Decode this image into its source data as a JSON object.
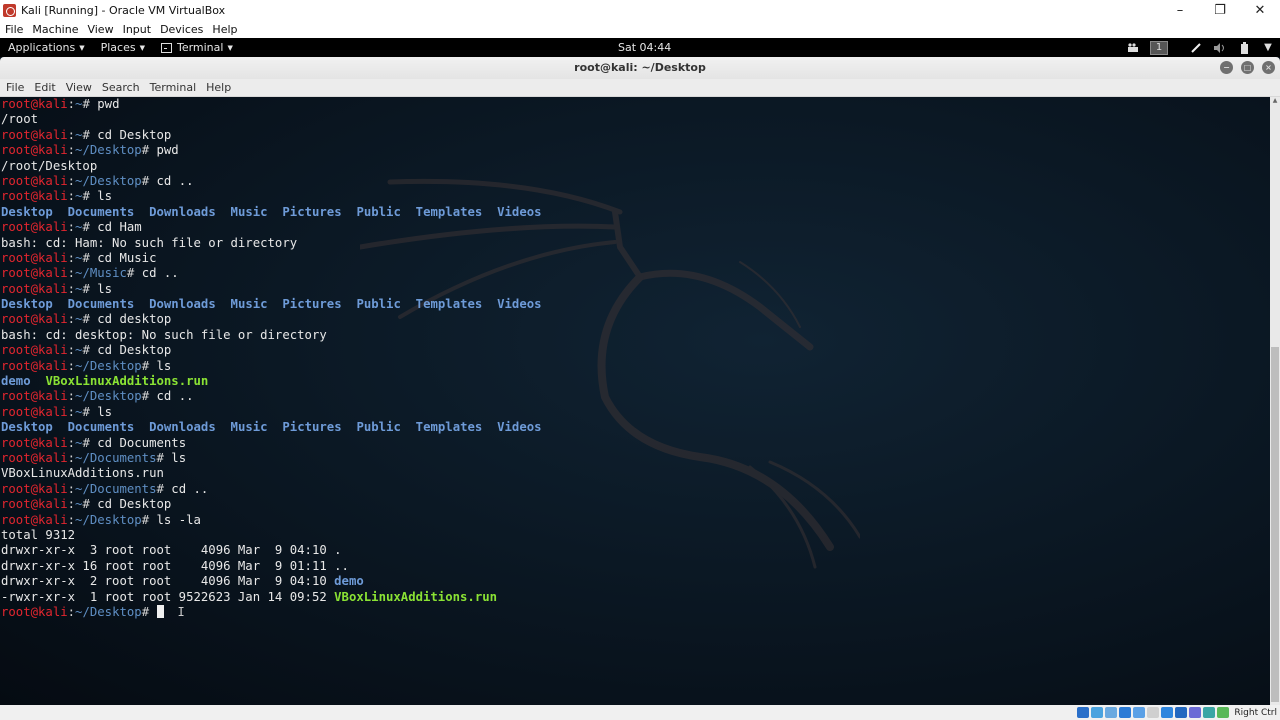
{
  "host": {
    "title": "Kali [Running] - Oracle VM VirtualBox",
    "controls": {
      "minimize": "–",
      "maximize": "❐",
      "close": "✕"
    },
    "menu": [
      "File",
      "Machine",
      "View",
      "Input",
      "Devices",
      "Help"
    ],
    "status": {
      "icons": [
        "hard-disk-icon",
        "optical-drive-icon",
        "audio-icon",
        "network-icon",
        "usb-icon",
        "shared-folder-icon",
        "display-icon",
        "video-capture-icon",
        "virtualbox-icon",
        "mouse-integration-icon",
        "keyboard-icon"
      ],
      "host_key": "Right Ctrl"
    }
  },
  "panel": {
    "applications": "Applications",
    "places": "Places",
    "terminal": "Terminal",
    "clock": "Sat 04:44",
    "workspace": "1",
    "caret": "▼"
  },
  "terminal": {
    "title": "root@kali: ~/Desktop",
    "controls": {
      "minimize": "−",
      "maximize": "□",
      "close": "×"
    },
    "menu": [
      "File",
      "Edit",
      "View",
      "Search",
      "Terminal",
      "Help"
    ],
    "prompt_user": "root@kali",
    "lines": [
      {
        "type": "prompt",
        "path": "~",
        "cmd": "pwd"
      },
      {
        "type": "out",
        "text": "/root"
      },
      {
        "type": "prompt",
        "path": "~",
        "cmd": "cd Desktop"
      },
      {
        "type": "prompt",
        "path": "~/Desktop",
        "cmd": "pwd"
      },
      {
        "type": "out",
        "text": "/root/Desktop"
      },
      {
        "type": "prompt",
        "path": "~/Desktop",
        "cmd": "cd .."
      },
      {
        "type": "prompt",
        "path": "~",
        "cmd": "ls"
      },
      {
        "type": "ls",
        "items": [
          {
            "t": "Desktop",
            "k": "dir"
          },
          {
            "t": "Documents",
            "k": "dir"
          },
          {
            "t": "Downloads",
            "k": "dir"
          },
          {
            "t": "Music",
            "k": "dir"
          },
          {
            "t": "Pictures",
            "k": "dir"
          },
          {
            "t": "Public",
            "k": "dir"
          },
          {
            "t": "Templates",
            "k": "dir"
          },
          {
            "t": "Videos",
            "k": "dir"
          }
        ]
      },
      {
        "type": "prompt",
        "path": "~",
        "cmd": "cd Ham"
      },
      {
        "type": "out",
        "text": "bash: cd: Ham: No such file or directory"
      },
      {
        "type": "prompt",
        "path": "~",
        "cmd": "cd Music"
      },
      {
        "type": "prompt",
        "path": "~/Music",
        "cmd": "cd .."
      },
      {
        "type": "prompt",
        "path": "~",
        "cmd": "ls"
      },
      {
        "type": "ls",
        "items": [
          {
            "t": "Desktop",
            "k": "dir"
          },
          {
            "t": "Documents",
            "k": "dir"
          },
          {
            "t": "Downloads",
            "k": "dir"
          },
          {
            "t": "Music",
            "k": "dir"
          },
          {
            "t": "Pictures",
            "k": "dir"
          },
          {
            "t": "Public",
            "k": "dir"
          },
          {
            "t": "Templates",
            "k": "dir"
          },
          {
            "t": "Videos",
            "k": "dir"
          }
        ]
      },
      {
        "type": "prompt",
        "path": "~",
        "cmd": "cd desktop"
      },
      {
        "type": "out",
        "text": "bash: cd: desktop: No such file or directory"
      },
      {
        "type": "prompt",
        "path": "~",
        "cmd": "cd Desktop"
      },
      {
        "type": "prompt",
        "path": "~/Desktop",
        "cmd": "ls"
      },
      {
        "type": "ls",
        "items": [
          {
            "t": "demo",
            "k": "dir"
          },
          {
            "t": "VBoxLinuxAdditions.run",
            "k": "exe"
          }
        ]
      },
      {
        "type": "prompt",
        "path": "~/Desktop",
        "cmd": "cd .."
      },
      {
        "type": "prompt",
        "path": "~",
        "cmd": "ls"
      },
      {
        "type": "ls",
        "items": [
          {
            "t": "Desktop",
            "k": "dir"
          },
          {
            "t": "Documents",
            "k": "dir"
          },
          {
            "t": "Downloads",
            "k": "dir"
          },
          {
            "t": "Music",
            "k": "dir"
          },
          {
            "t": "Pictures",
            "k": "dir"
          },
          {
            "t": "Public",
            "k": "dir"
          },
          {
            "t": "Templates",
            "k": "dir"
          },
          {
            "t": "Videos",
            "k": "dir"
          }
        ]
      },
      {
        "type": "prompt",
        "path": "~",
        "cmd": "cd Documents"
      },
      {
        "type": "prompt",
        "path": "~/Documents",
        "cmd": "ls"
      },
      {
        "type": "out",
        "text": "VBoxLinuxAdditions.run"
      },
      {
        "type": "prompt",
        "path": "~/Documents",
        "cmd": "cd .."
      },
      {
        "type": "prompt",
        "path": "~",
        "cmd": "cd Desktop"
      },
      {
        "type": "prompt",
        "path": "~/Desktop",
        "cmd": "ls -la"
      },
      {
        "type": "out",
        "text": "total 9312"
      },
      {
        "type": "lsl",
        "text": "drwxr-xr-x  3 root root    4096 Mar  9 04:10 ",
        "name": ".",
        "k": "plain"
      },
      {
        "type": "lsl",
        "text": "drwxr-xr-x 16 root root    4096 Mar  9 01:11 ",
        "name": "..",
        "k": "plain"
      },
      {
        "type": "lsl",
        "text": "drwxr-xr-x  2 root root    4096 Mar  9 04:10 ",
        "name": "demo",
        "k": "dir"
      },
      {
        "type": "lsl",
        "text": "-rwxr-xr-x  1 root root 9522623 Jan 14 09:52 ",
        "name": "VBoxLinuxAdditions.run",
        "k": "exe"
      },
      {
        "type": "prompt",
        "path": "~/Desktop",
        "cmd": "",
        "cursor": true
      }
    ]
  },
  "colors": {
    "prompt_user": "#e3262f",
    "prompt_path": "#5f8fc4",
    "directory": "#6e9bd8",
    "executable": "#8ae234",
    "terminal_bg": "#0b1824"
  }
}
